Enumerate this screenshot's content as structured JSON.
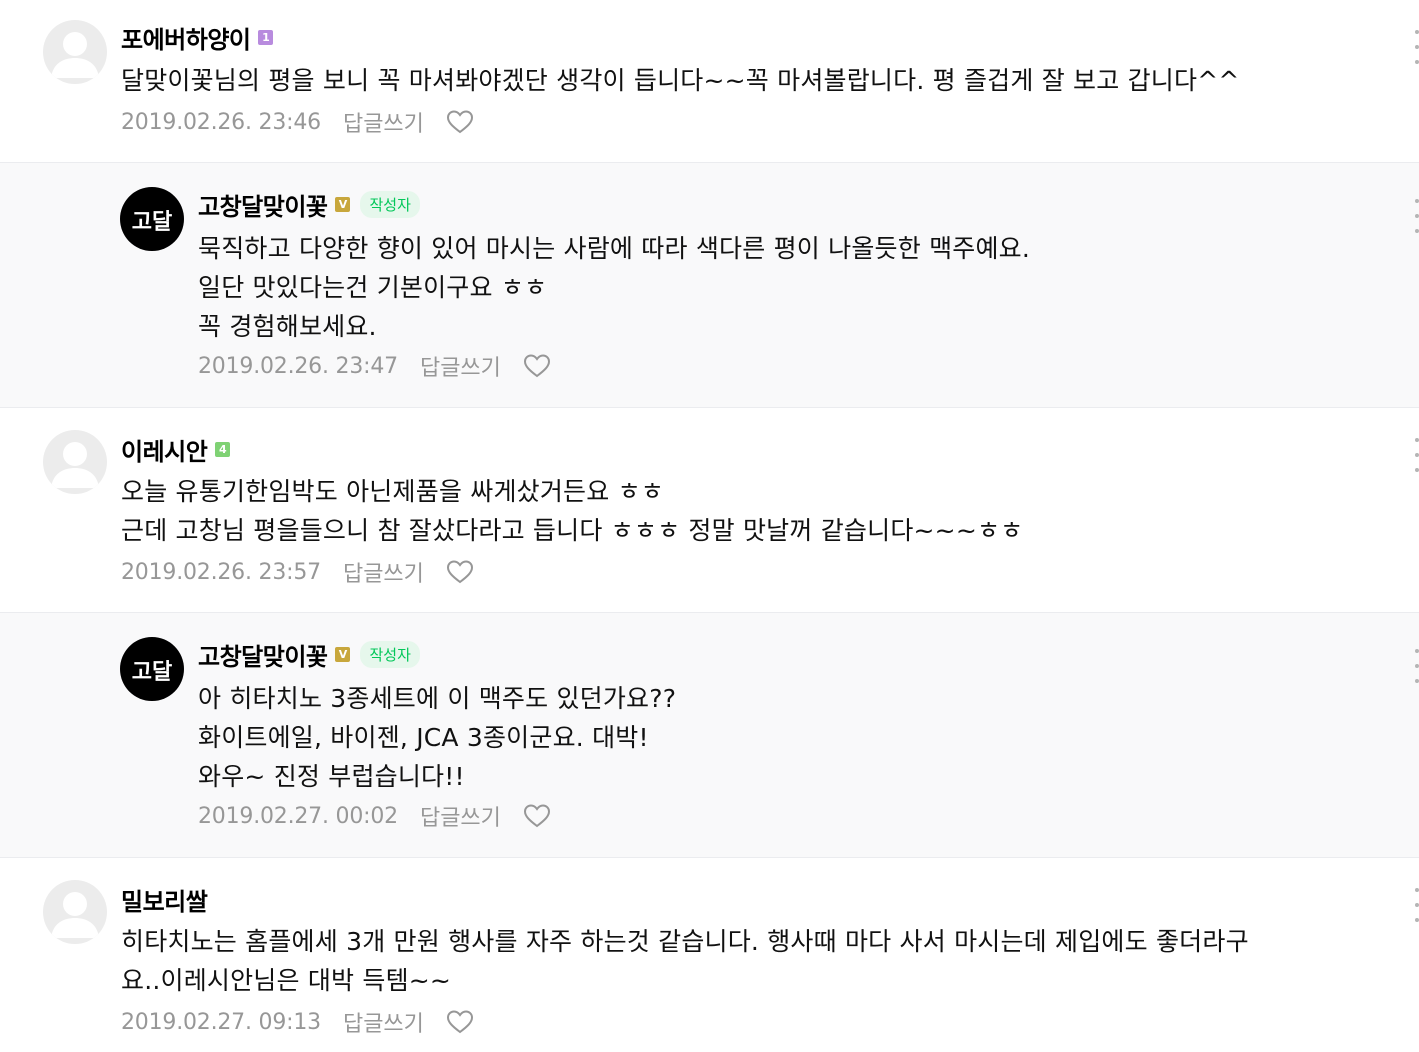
{
  "comments": [
    {
      "nickname": "포에버하양이",
      "level": "1",
      "text_lines": [
        "달맞이꽃님의 평을 보니 꼭 마셔봐야겠단 생각이 듭니다~~꼭 마셔볼랍니다. 평 즐겁게 잘 보고 갑니다^^"
      ],
      "date": "2019.02.26. 23:46",
      "reply_label": "답글쓰기"
    },
    {
      "nickname": "고창달맞이꽃",
      "level": "V",
      "author_tag": "작성자",
      "text_lines": [
        "묵직하고 다양한 향이 있어 마시는 사람에 따라 색다른 평이 나올듯한 맥주예요.",
        "일단 맛있다는건 기본이구요 ㅎㅎ",
        "꼭 경험해보세요."
      ],
      "date": "2019.02.26. 23:47",
      "reply_label": "답글쓰기"
    },
    {
      "nickname": "이레시안",
      "level": "4",
      "text_lines": [
        "오늘 유통기한임박도 아닌제품을 싸게샀거든요 ㅎㅎ",
        "근데 고창님 평을들으니 참 잘샀다라고 듭니다 ㅎㅎㅎ 정말 맛날꺼 같습니다~~~ㅎㅎ"
      ],
      "date": "2019.02.26. 23:57",
      "reply_label": "답글쓰기"
    },
    {
      "nickname": "고창달맞이꽃",
      "level": "V",
      "author_tag": "작성자",
      "text_lines": [
        "아 히타치노 3종세트에 이 맥주도 있던가요??",
        "화이트에일, 바이젠, JCA 3종이군요. 대박!",
        "와우~ 진정 부럽습니다!!"
      ],
      "date": "2019.02.27. 00:02",
      "reply_label": "답글쓰기"
    },
    {
      "nickname": "밀보리쌀",
      "text_lines": [
        "히타치노는 홈플에세 3개 만원 행사를 자주 하는것 같습니다. 행사때 마다 사서 마시는데 제입에도 좋더라구",
        "요..이레시안님은 대박 득템~~"
      ],
      "date": "2019.02.27. 09:13",
      "reply_label": "답글쓰기"
    }
  ],
  "brand_avatar_text": "고달",
  "colors": {
    "reply_background": "#f9f9fa",
    "meta_gray": "#979797",
    "author_tag_green": "#03c75a",
    "level1_purple": "#b88bde",
    "level4_green": "#7fd274",
    "manager_gold": "#c8a73c"
  }
}
